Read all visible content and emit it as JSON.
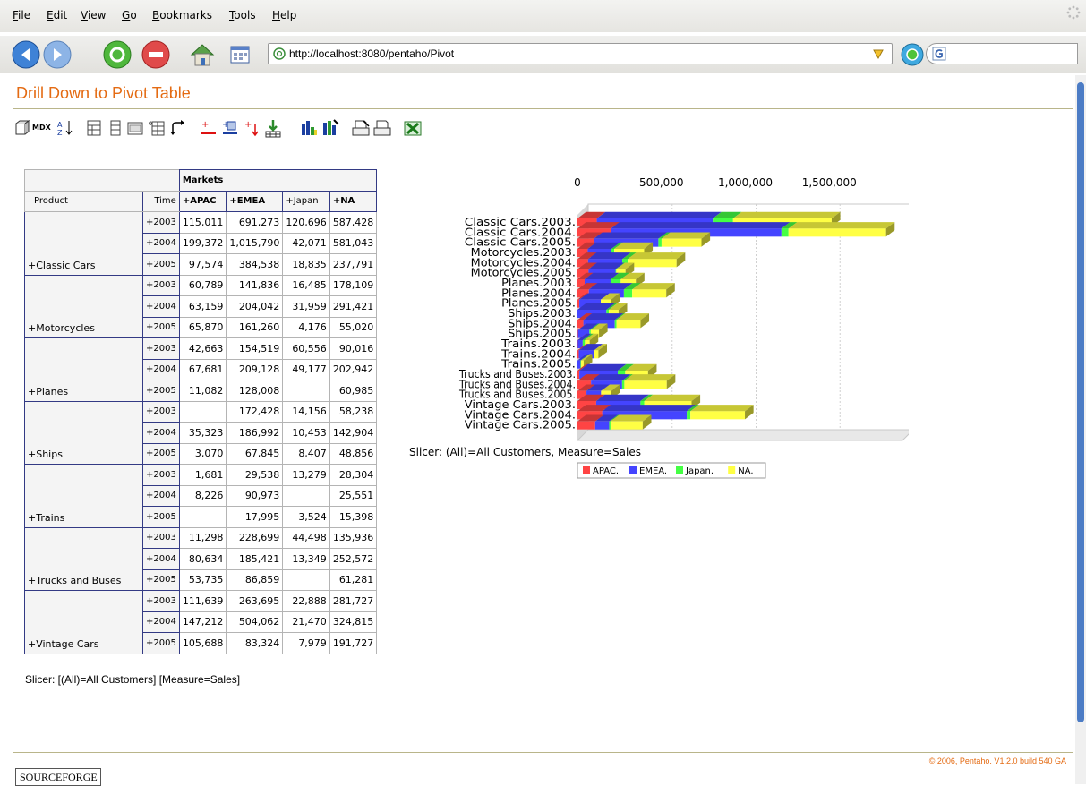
{
  "menu": [
    "File",
    "Edit",
    "View",
    "Go",
    "Bookmarks",
    "Tools",
    "Help"
  ],
  "address": {
    "url": "http://localhost:8080/pentaho/Pivot"
  },
  "page": {
    "title": "Drill Down to Pivot Table"
  },
  "toolbar": {
    "mdx_label": "MDX"
  },
  "table": {
    "markets_header": "Markets",
    "product_header": "Product",
    "time_header": "Time",
    "columns": [
      "+APAC",
      "+EMEA",
      "+Japan",
      "+NA"
    ],
    "groups": [
      {
        "product": "+Classic Cars",
        "rows": [
          {
            "year": "+2003",
            "values": [
              "115,011",
              "691,273",
              "120,696",
              "587,428"
            ]
          },
          {
            "year": "+2004",
            "values": [
              "199,372",
              "1,015,790",
              "42,071",
              "581,043"
            ]
          },
          {
            "year": "+2005",
            "values": [
              "97,574",
              "384,538",
              "18,835",
              "237,791"
            ]
          }
        ]
      },
      {
        "product": "+Motorcycles",
        "rows": [
          {
            "year": "+2003",
            "values": [
              "60,789",
              "141,836",
              "16,485",
              "178,109"
            ]
          },
          {
            "year": "+2004",
            "values": [
              "63,159",
              "204,042",
              "31,959",
              "291,421"
            ]
          },
          {
            "year": "+2005",
            "values": [
              "65,870",
              "161,260",
              "4,176",
              "55,020"
            ]
          }
        ]
      },
      {
        "product": "+Planes",
        "rows": [
          {
            "year": "+2003",
            "values": [
              "42,663",
              "154,519",
              "60,556",
              "90,016"
            ]
          },
          {
            "year": "+2004",
            "values": [
              "67,681",
              "209,128",
              "49,177",
              "202,942"
            ]
          },
          {
            "year": "+2005",
            "values": [
              "11,082",
              "128,008",
              "",
              "60,985"
            ]
          }
        ]
      },
      {
        "product": "+Ships",
        "rows": [
          {
            "year": "+2003",
            "values": [
              "",
              "172,428",
              "14,156",
              "58,238"
            ]
          },
          {
            "year": "+2004",
            "values": [
              "35,323",
              "186,992",
              "10,453",
              "142,904"
            ]
          },
          {
            "year": "+2005",
            "values": [
              "3,070",
              "67,845",
              "8,407",
              "48,856"
            ]
          }
        ]
      },
      {
        "product": "+Trains",
        "rows": [
          {
            "year": "+2003",
            "values": [
              "1,681",
              "29,538",
              "13,279",
              "28,304"
            ]
          },
          {
            "year": "+2004",
            "values": [
              "8,226",
              "90,973",
              "",
              "25,551"
            ]
          },
          {
            "year": "+2005",
            "values": [
              "",
              "17,995",
              "3,524",
              "15,398"
            ]
          }
        ]
      },
      {
        "product": "+Trucks and Buses",
        "rows": [
          {
            "year": "+2003",
            "values": [
              "11,298",
              "228,699",
              "44,498",
              "135,936"
            ]
          },
          {
            "year": "+2004",
            "values": [
              "80,634",
              "185,421",
              "13,349",
              "252,572"
            ]
          },
          {
            "year": "+2005",
            "values": [
              "53,735",
              "86,859",
              "",
              "61,281"
            ]
          }
        ]
      },
      {
        "product": "+Vintage Cars",
        "rows": [
          {
            "year": "+2003",
            "values": [
              "111,639",
              "263,695",
              "22,888",
              "281,727"
            ]
          },
          {
            "year": "+2004",
            "values": [
              "147,212",
              "504,062",
              "21,470",
              "324,815"
            ]
          },
          {
            "year": "+2005",
            "values": [
              "105,688",
              "83,324",
              "7,979",
              "191,727"
            ]
          }
        ]
      }
    ]
  },
  "slicer_text": "Slicer: [(All)=All Customers] [Measure=Sales]",
  "copyright": "© 2006, Pentaho. V1.2.0 build 540 GA",
  "sourceforge_label": "SOURCEFORGE",
  "chart_data": {
    "type": "bar",
    "orientation": "horizontal",
    "stacked": true,
    "three_d": true,
    "subtitle": "Slicer: (All)=All Customers, Measure=Sales",
    "xlim": [
      0,
      2000000
    ],
    "x_ticks": [
      "0",
      "500,000",
      "1,000,000",
      "1,500,000"
    ],
    "x_tick_values": [
      0,
      500000,
      1000000,
      1500000
    ],
    "categories": [
      "Classic Cars.2003.",
      "Classic Cars.2004.",
      "Classic Cars.2005.",
      "Motorcycles.2003.",
      "Motorcycles.2004.",
      "Motorcycles.2005.",
      "Planes.2003.",
      "Planes.2004.",
      "Planes.2005.",
      "Ships.2003.",
      "Ships.2004.",
      "Ships.2005.",
      "Trains.2003.",
      "Trains.2004.",
      "Trains.2005.",
      "Trucks and Buses.2003.",
      "Trucks and Buses.2004.",
      "Trucks and Buses.2005.",
      "Vintage Cars.2003.",
      "Vintage Cars.2004.",
      "Vintage Cars.2005."
    ],
    "series": [
      {
        "name": "APAC.",
        "color": "#ff4444",
        "values": [
          115011,
          199372,
          97574,
          60789,
          63159,
          65870,
          42663,
          67681,
          11082,
          0,
          35323,
          3070,
          1681,
          8226,
          0,
          11298,
          80634,
          53735,
          111639,
          147212,
          105688
        ]
      },
      {
        "name": "EMEA.",
        "color": "#4444ff",
        "values": [
          691273,
          1015790,
          384538,
          141836,
          204042,
          161260,
          154519,
          209128,
          128008,
          172428,
          186992,
          67845,
          29538,
          90973,
          17995,
          228699,
          185421,
          86859,
          263695,
          504062,
          83324
        ]
      },
      {
        "name": "Japan.",
        "color": "#44ff44",
        "values": [
          120696,
          42071,
          18835,
          16485,
          31959,
          4176,
          60556,
          49177,
          0,
          14156,
          10453,
          8407,
          13279,
          0,
          3524,
          44498,
          13349,
          0,
          22888,
          21470,
          7979
        ]
      },
      {
        "name": "NA.",
        "color": "#ffff44",
        "values": [
          587428,
          581043,
          237791,
          178109,
          291421,
          55020,
          90016,
          202942,
          60985,
          58238,
          142904,
          48856,
          28304,
          25551,
          15398,
          135936,
          252572,
          61281,
          281727,
          324815,
          191727
        ]
      }
    ],
    "legend_position": "bottom"
  }
}
